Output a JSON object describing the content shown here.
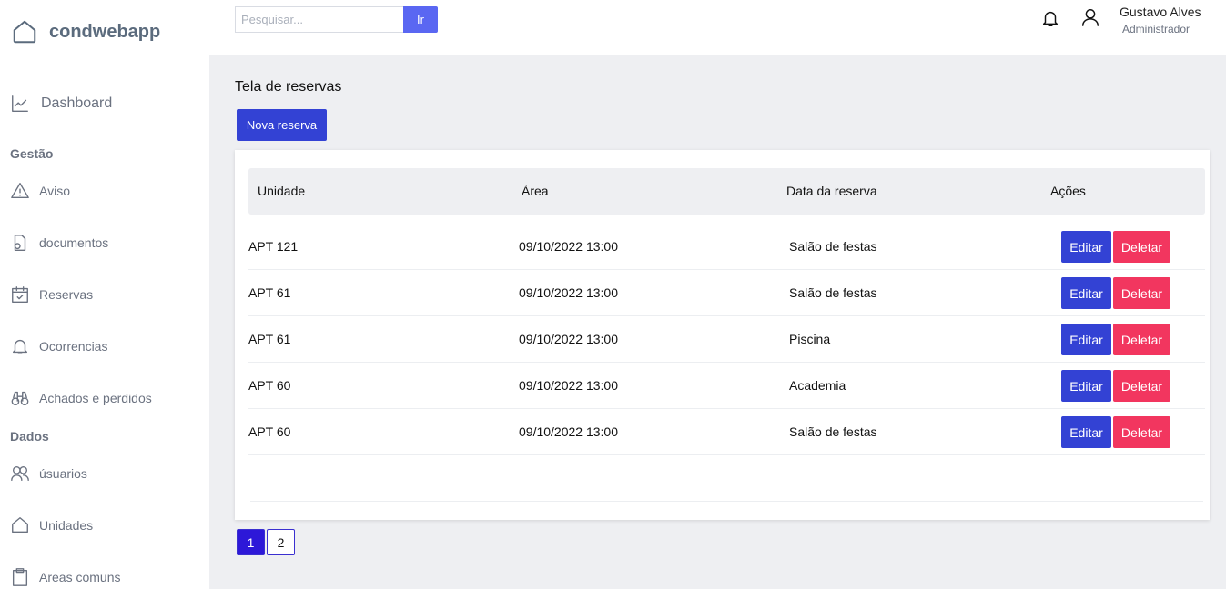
{
  "brand": {
    "name": "condwebapp"
  },
  "search": {
    "placeholder": "Pesquisar...",
    "button_label": "Ir"
  },
  "user": {
    "name": "Gustavo Alves",
    "role": "Administrador"
  },
  "sidebar": {
    "dashboard": "Dashboard",
    "section_gestao": "Gestão",
    "section_dados": "Dados",
    "items": [
      {
        "label": "Aviso",
        "icon": "alert-triangle-icon"
      },
      {
        "label": "documentos",
        "icon": "document-icon"
      },
      {
        "label": "Reservas",
        "icon": "calendar-check-icon"
      },
      {
        "label": "Ocorrencias",
        "icon": "bell-icon"
      },
      {
        "label": "Achados e perdidos",
        "icon": "binoculars-icon"
      },
      {
        "label": "úsuarios",
        "icon": "users-icon"
      },
      {
        "label": "Unidades",
        "icon": "home-icon"
      },
      {
        "label": "Areas comuns",
        "icon": "clipboard-icon"
      }
    ]
  },
  "page": {
    "title": "Tela de reservas",
    "new_button": "Nova reserva"
  },
  "table": {
    "columns": [
      "Unidade",
      "Àrea",
      "Data da reserva",
      "Ações"
    ],
    "rows": [
      {
        "unidade": "APT 121",
        "area": "09/10/2022 13:00",
        "data": "Salão de festas"
      },
      {
        "unidade": "APT 61",
        "area": "09/10/2022 13:00",
        "data": "Salão de festas"
      },
      {
        "unidade": "APT 61",
        "area": "09/10/2022 13:00",
        "data": "Piscina"
      },
      {
        "unidade": "APT 60",
        "area": "09/10/2022 13:00",
        "data": "Academia"
      },
      {
        "unidade": "APT 60",
        "area": "09/10/2022 13:00",
        "data": "Salão de festas"
      }
    ],
    "edit_label": "Editar",
    "delete_label": "Deletar"
  },
  "pagination": {
    "pages": [
      "1",
      "2"
    ],
    "active": "1"
  },
  "colors": {
    "primary": "#3342d4",
    "danger": "#f2365f",
    "page_active": "#2d18d8",
    "search_button": "#5a67f2",
    "background": "#eeeff2"
  }
}
